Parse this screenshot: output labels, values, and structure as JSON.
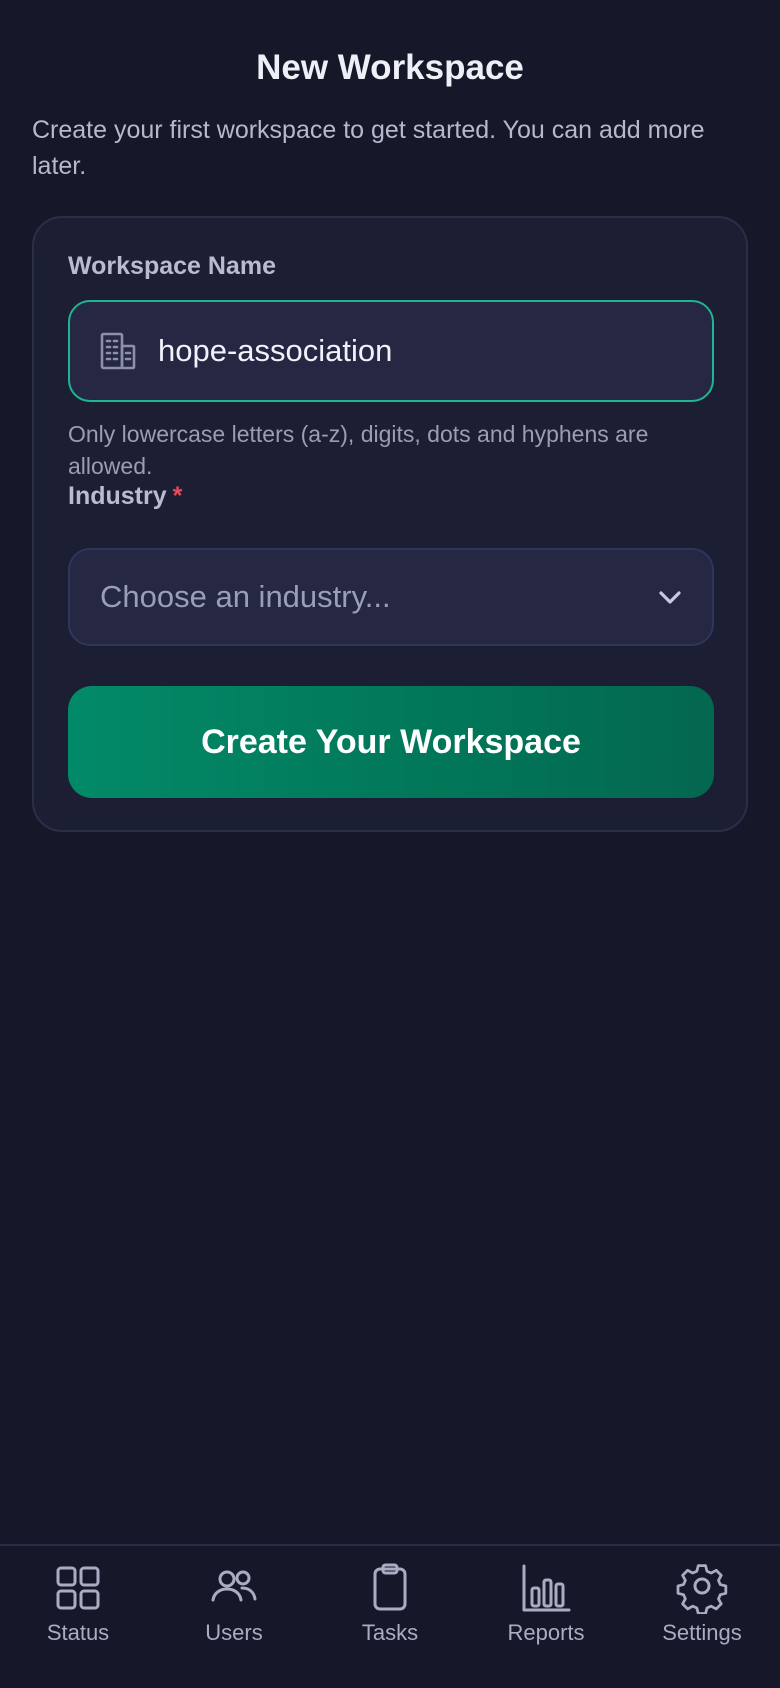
{
  "header": {
    "title": "New Workspace",
    "subtitle": "Create your first workspace to get started. You can add more later."
  },
  "form": {
    "workspace_name": {
      "label": "Workspace Name",
      "value": "hope-association",
      "icon": "building-icon",
      "help": "Only lowercase letters (a-z), digits, dots and hyphens are allowed."
    },
    "industry": {
      "label": "Industry",
      "required_mark": "*",
      "placeholder": "Choose an industry...",
      "icon": "chevron-down-icon"
    },
    "submit_label": "Create Your Workspace"
  },
  "tabbar": {
    "items": [
      {
        "label": "Status",
        "icon": "grid-icon"
      },
      {
        "label": "Users",
        "icon": "users-icon"
      },
      {
        "label": "Tasks",
        "icon": "clipboard-icon"
      },
      {
        "label": "Reports",
        "icon": "bar-chart-icon"
      },
      {
        "label": "Settings",
        "icon": "gear-icon"
      }
    ]
  },
  "colors": {
    "background": "#161729",
    "card": "#1c1e33",
    "accent": "#1fb590",
    "button": "#018064",
    "required": "#ef4a5a"
  }
}
